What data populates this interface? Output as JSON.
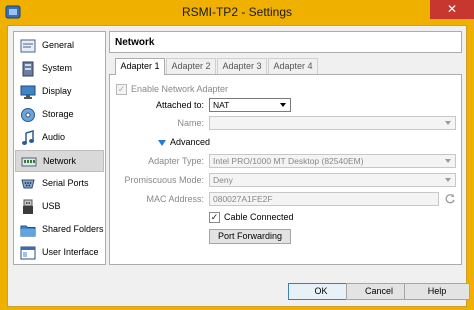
{
  "window": {
    "title": "RSMI-TP2 - Settings",
    "close_glyph": "✕"
  },
  "sidebar": {
    "items": [
      {
        "label": "General",
        "icon": "general-icon",
        "selected": false
      },
      {
        "label": "System",
        "icon": "system-icon",
        "selected": false
      },
      {
        "label": "Display",
        "icon": "display-icon",
        "selected": false
      },
      {
        "label": "Storage",
        "icon": "storage-icon",
        "selected": false
      },
      {
        "label": "Audio",
        "icon": "audio-icon",
        "selected": false
      },
      {
        "label": "Network",
        "icon": "network-icon",
        "selected": true
      },
      {
        "label": "Serial Ports",
        "icon": "serial-ports-icon",
        "selected": false
      },
      {
        "label": "USB",
        "icon": "usb-icon",
        "selected": false
      },
      {
        "label": "Shared Folders",
        "icon": "shared-folders-icon",
        "selected": false
      },
      {
        "label": "User Interface",
        "icon": "user-interface-icon",
        "selected": false
      }
    ]
  },
  "panel": {
    "header": "Network"
  },
  "tabs": [
    {
      "label": "Adapter 1",
      "active": true
    },
    {
      "label": "Adapter 2",
      "active": false
    },
    {
      "label": "Adapter 3",
      "active": false
    },
    {
      "label": "Adapter 4",
      "active": false
    }
  ],
  "form": {
    "enable_adapter_label": "Enable Network Adapter",
    "enable_adapter_checked": true,
    "attached_to_label": "Attached to:",
    "attached_to_value": "NAT",
    "name_label": "Name:",
    "name_value": "",
    "advanced_label": "Advanced",
    "adapter_type_label": "Adapter Type:",
    "adapter_type_value": "Intel PRO/1000 MT Desktop (82540EM)",
    "promiscuous_label": "Promiscuous Mode:",
    "promiscuous_value": "Deny",
    "mac_label": "MAC Address:",
    "mac_value": "080027A1FE2F",
    "cable_label": "Cable Connected",
    "cable_checked": true,
    "check_glyph": "✓",
    "port_forwarding_label": "Port Forwarding"
  },
  "footer": {
    "ok_label": "OK",
    "cancel_label": "Cancel",
    "help_label": "Help"
  },
  "colors": {
    "title_bar": "#f0b000",
    "close_button": "#c7372f",
    "advanced_triangle": "#1f7fd8"
  }
}
